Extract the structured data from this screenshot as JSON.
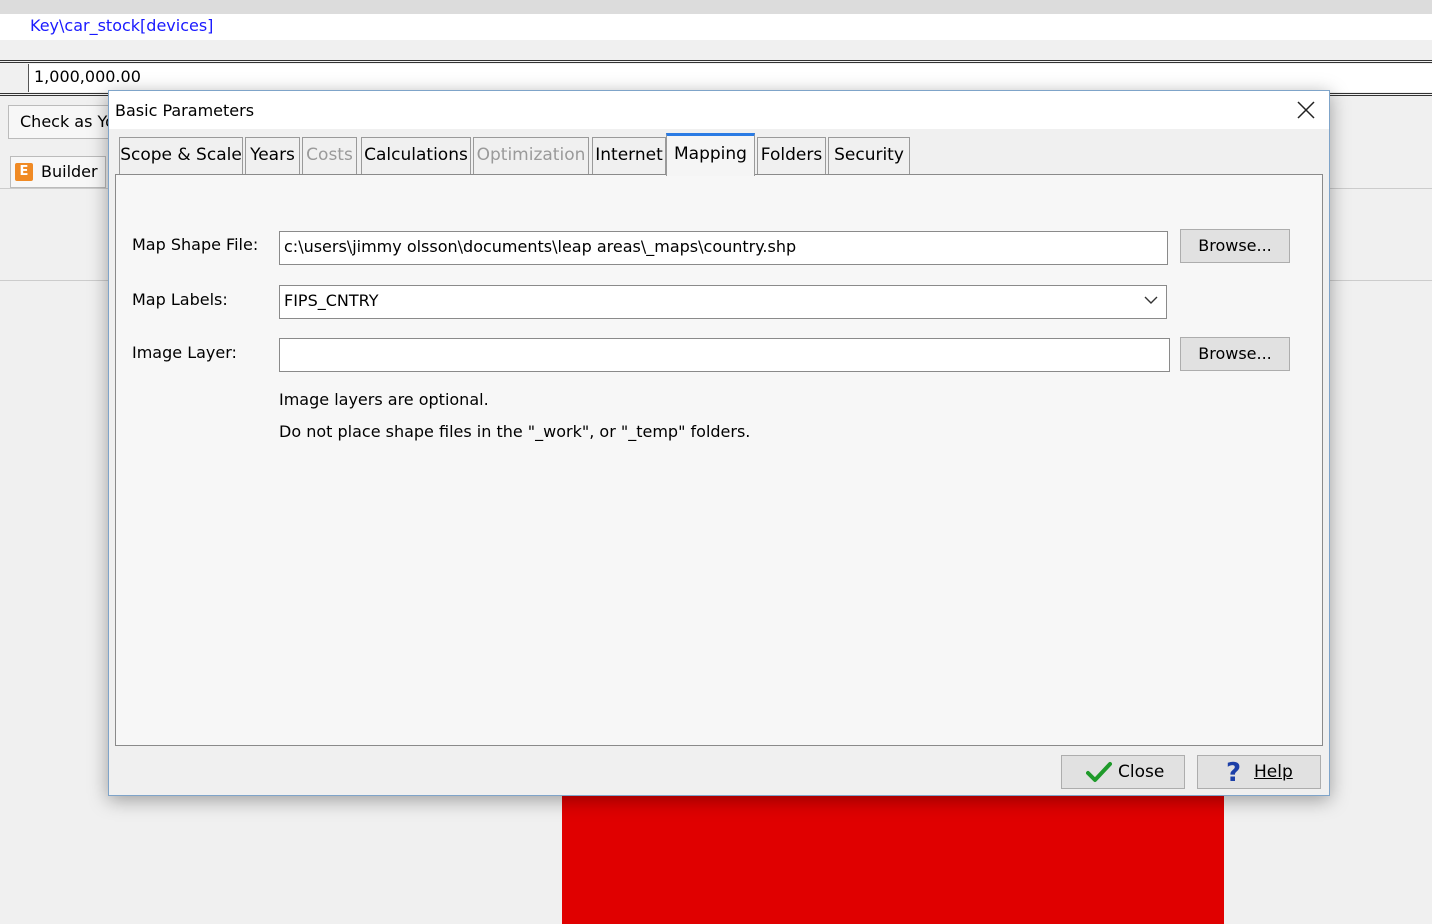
{
  "background": {
    "key_path": "Key\\car_stock[devices]",
    "value_field": "1,000,000.00",
    "check_button_label": "Check as Yo",
    "builder_tab_label": "Builder",
    "builder_icon_letter": "E",
    "accent_red": "#e00000"
  },
  "dialog": {
    "title": "Basic Parameters",
    "tabs": [
      {
        "label": "Scope & Scale",
        "state": "normal"
      },
      {
        "label": "Years",
        "state": "normal"
      },
      {
        "label": "Costs",
        "state": "disabled"
      },
      {
        "label": "Calculations",
        "state": "normal"
      },
      {
        "label": "Optimization",
        "state": "disabled"
      },
      {
        "label": "Internet",
        "state": "normal"
      },
      {
        "label": "Mapping",
        "state": "active"
      },
      {
        "label": "Folders",
        "state": "normal"
      },
      {
        "label": "Security",
        "state": "normal"
      }
    ],
    "mapping": {
      "shape_file_label": "Map Shape File:",
      "shape_file_value": "c:\\users\\jimmy olsson\\documents\\leap areas\\_maps\\country.shp",
      "browse_label": "Browse...",
      "map_labels_label": "Map Labels:",
      "map_labels_value": "FIPS_CNTRY",
      "image_layer_label": "Image Layer:",
      "image_layer_value": "",
      "browse2_label": "Browse...",
      "note1": "Image layers are optional.",
      "note2": "Do not place shape files in the \"_work\", or \"_temp\" folders."
    },
    "footer": {
      "close_label": "Close",
      "help_label": "Help"
    },
    "accent_color": "#2a7be4"
  }
}
